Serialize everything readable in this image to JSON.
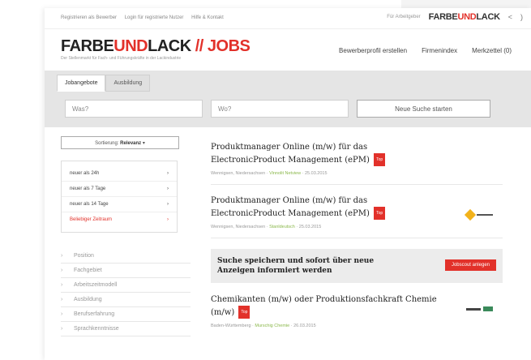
{
  "topbar": {
    "links": [
      "Registrieren als Bewerber",
      "Login für registrierte Nutzer",
      "Hilfe & Kontakt"
    ],
    "for_employers": "Für Arbeitgeber",
    "mini_logo_a": "FARBE",
    "mini_logo_b": "UND",
    "mini_logo_c": "LACK",
    "icons": [
      "share-icon",
      "rss-icon"
    ]
  },
  "header": {
    "logo_a": "FARBE",
    "logo_b": "UND",
    "logo_c": "LACK",
    "logo_d": " // JOBS",
    "tagline": "Der Stellenmarkt für Fach- und Führungskräfte in der Lackindustrie",
    "nav": [
      "Bewerberprofil erstellen",
      "Firmenindex",
      "Merkzettel (0)"
    ]
  },
  "search": {
    "tabs": [
      "Jobangebote",
      "Ausbildung"
    ],
    "what_placeholder": "Was?",
    "where_placeholder": "Wo?",
    "submit_label": "Neue Suche starten"
  },
  "sidebar": {
    "sort_prefix": "Sortierung: ",
    "sort_value": "Relevanz",
    "date_filters": [
      "neuer als 24h",
      "neuer als 7 Tage",
      "neuer als 14 Tage",
      "Beliebiger Zeitraum"
    ],
    "facets": [
      "Position",
      "Fachgebiet",
      "Arbeitszeitmodell",
      "Ausbildung",
      "Berufserfahrung",
      "Sprachkenntnisse"
    ]
  },
  "results": {
    "badge": "Top",
    "jobs": [
      {
        "title": "Produktmanager Online (m/w) für das ElectronicProduct Management (ePM)",
        "location": "Wennigsen, Niedersachsen",
        "company": "Vinnolit Netview",
        "date": "25.03.2015"
      },
      {
        "title": "Produktmanager Online (m/w) für das ElectronicProduct Management (ePM)",
        "location": "Wennigsen, Niedersachsen",
        "company": "Stanldeutsch",
        "date": "25.03.2015"
      },
      {
        "title": "Chemikanten (m/w) oder Produktionsfachkraft Chemie (m/w)",
        "location": "Baden-Württemberg",
        "company": "Murschig Chemie",
        "date": "26.03.2015"
      }
    ],
    "save_text": "Suche speichern und sofort über neue Anzeigen informiert werden",
    "save_button": "Jobscout anlegen"
  }
}
